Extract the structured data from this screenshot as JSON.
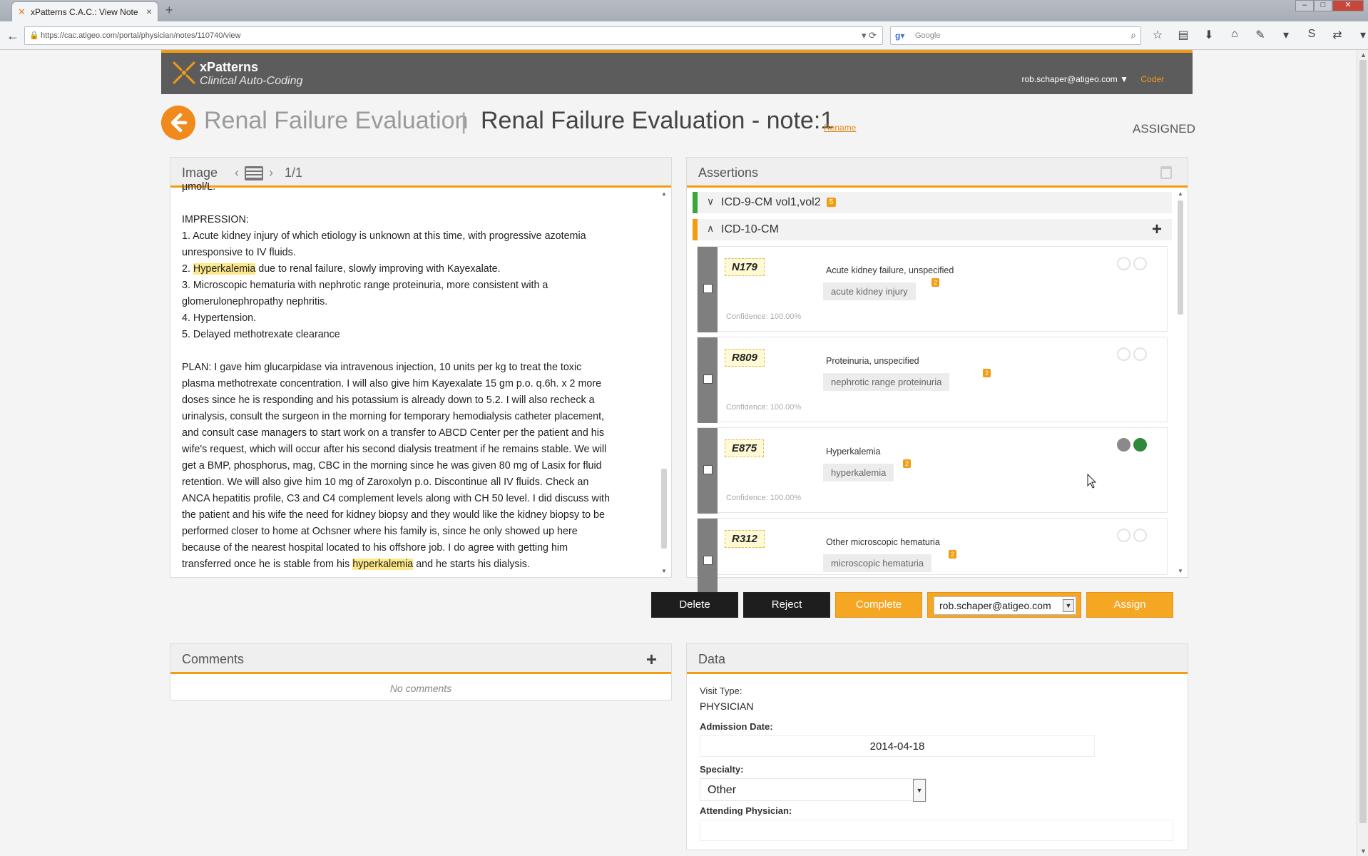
{
  "browser": {
    "tab_title": "xPatterns C.A.C.: View Note",
    "url": "https://cac.atigeo.com/portal/physician/notes/110740/view",
    "search_placeholder": "Google"
  },
  "header": {
    "brand_name": "xPatterns",
    "brand_tagline": "Clinical Auto-Coding",
    "user_email": "rob.schaper@atigeo.com",
    "user_role": "Coder"
  },
  "title": {
    "case_name": "Renal Failure Evaluation",
    "separator": "|",
    "note_name": "Renal Failure Evaluation - note:1",
    "rename_label": "Rename",
    "status": "ASSIGNED"
  },
  "image_panel": {
    "title": "Image",
    "page_count": "1/1",
    "note_lines": [
      "μmol/L.",
      "",
      "IMPRESSION:",
      "1. Acute kidney injury of which etiology is unknown at this time, with progressive azotemia",
      "unresponsive to IV fluids.",
      "2. |Hyperkalemia| due to renal failure, slowly improving with Kayexalate.",
      "3. Microscopic hematuria with nephrotic range proteinuria, more consistent with a",
      "glomerulonephropathy nephritis.",
      "4. Hypertension.",
      "5. Delayed methotrexate clearance",
      "",
      "PLAN: I gave him glucarpidase via intravenous injection, 10 units per kg to treat the toxic",
      "plasma methotrexate concentration. I will also give him Kayexalate 15 gm p.o. q.6h. x 2 more",
      "doses since he is responding and his potassium is already down to 5.2. I will also recheck a",
      "urinalysis, consult the surgeon in the morning for temporary hemodialysis catheter placement,",
      "and consult case managers to start work on a transfer to ABCD Center per the patient and his",
      "wife's request, which will occur after his second dialysis treatment if he remains stable. We will",
      "get a BMP, phosphorus, mag, CBC in the morning since he was given 80 mg of Lasix for fluid",
      "retention. We will also give him 10 mg of Zaroxolyn p.o. Discontinue all IV fluids. Check an",
      "ANCA hepatitis profile, C3 and C4 complement levels along with CH 50 level. I did discuss with",
      "the patient and his wife the need for kidney biopsy and they would like the kidney biopsy to be",
      "performed closer to home at Ochsner where his family is, since he only showed up here",
      "because of the nearest hospital located to his offshore job. I do agree with getting him",
      "transferred once he is stable from his |hyperkalemia| and he starts his dialysis."
    ]
  },
  "assertions": {
    "title": "Assertions",
    "groups": [
      {
        "label": "ICD-9-CM vol1,vol2",
        "count": "5",
        "collapsed": true
      },
      {
        "label": "ICD-10-CM",
        "collapsed": false
      }
    ],
    "cards": [
      {
        "code": "N179",
        "description": "Acute kidney failure, unspecified",
        "evidence": "acute kidney injury",
        "evidence_count": "2",
        "confidence": "Confidence: 100.00%",
        "active": false
      },
      {
        "code": "R809",
        "description": "Proteinuria, unspecified",
        "evidence": "nephrotic range proteinuria",
        "evidence_count": "2",
        "confidence": "Confidence: 100.00%",
        "active": false
      },
      {
        "code": "E875",
        "description": "Hyperkalemia",
        "evidence": "hyperkalemia",
        "evidence_count": "2",
        "confidence": "Confidence: 100.00%",
        "active": true
      },
      {
        "code": "R312",
        "description": "Other microscopic hematuria",
        "evidence": "microscopic hematuria",
        "evidence_count": "2",
        "confidence": "",
        "active": false
      }
    ]
  },
  "actions": {
    "delete_label": "Delete",
    "reject_label": "Reject",
    "complete_label": "Complete",
    "assignee": "rob.schaper@atigeo.com",
    "assign_label": "Assign"
  },
  "comments": {
    "title": "Comments",
    "empty_text": "No comments"
  },
  "data_panel": {
    "title": "Data",
    "visit_type_label": "Visit Type:",
    "visit_type_value": "PHYSICIAN",
    "admission_date_label": "Admission Date:",
    "admission_date_value": "2014-04-18",
    "specialty_label": "Specialty:",
    "specialty_value": "Other",
    "attending_label": "Attending Physician:",
    "attending_value": ""
  },
  "colors": {
    "accent": "#f39c12",
    "icd9_bar": "#3aa53a",
    "icd10_bar": "#f39c12",
    "highlight": "#fde88a"
  }
}
